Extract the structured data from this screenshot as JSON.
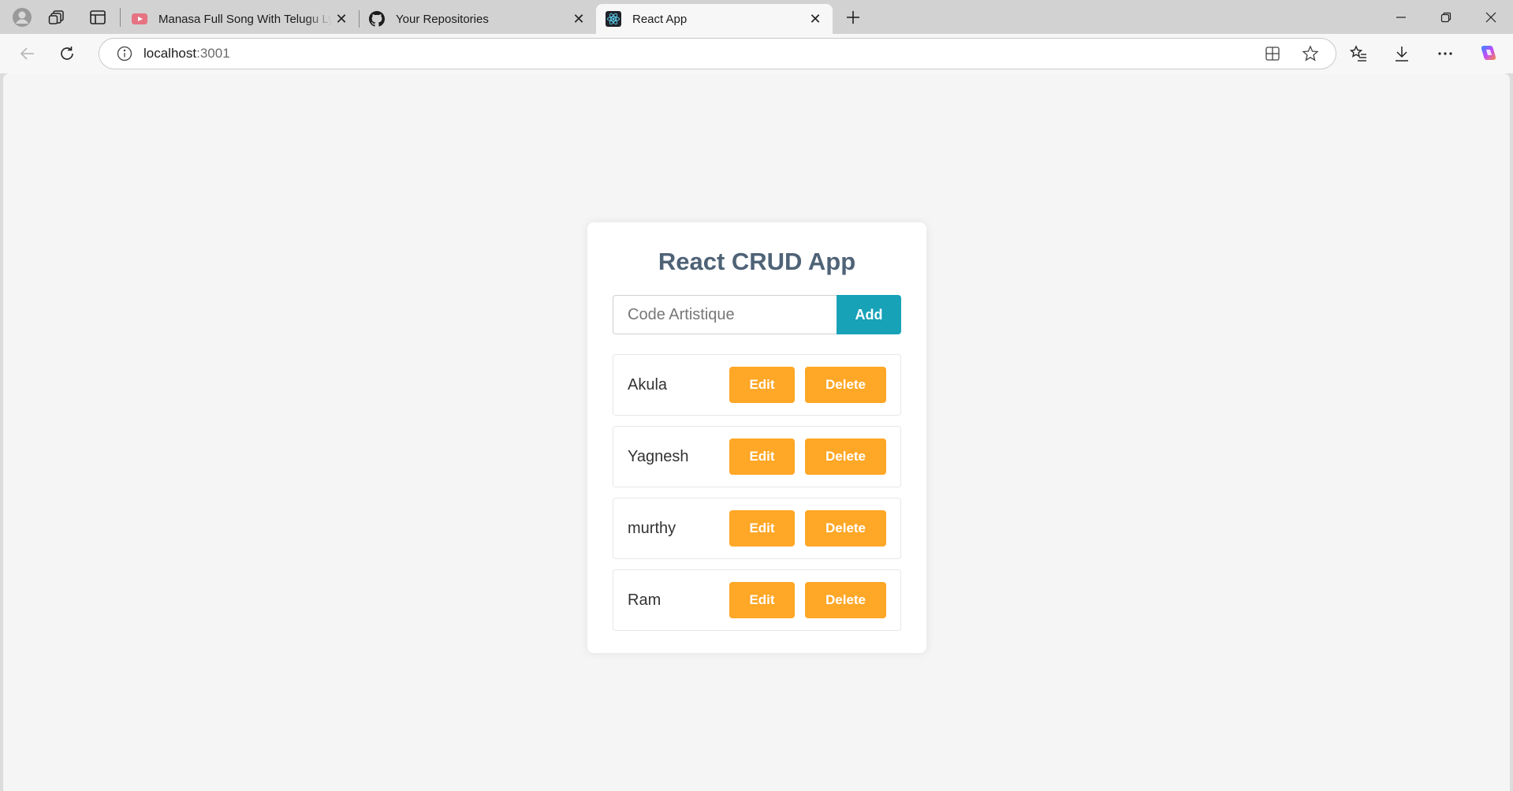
{
  "browser": {
    "tabs": [
      {
        "title": "Manasa Full Song With Telugu Lyrics",
        "favicon": "youtube-icon",
        "active": false
      },
      {
        "title": "Your Repositories",
        "favicon": "github-icon",
        "active": false
      },
      {
        "title": "React App",
        "favicon": "react-icon",
        "active": true
      }
    ],
    "address": {
      "host": "localhost",
      "port": ":3001"
    }
  },
  "app": {
    "title": "React CRUD App",
    "input": {
      "value": "",
      "placeholder": "Code Artistique"
    },
    "add_label": "Add",
    "items": [
      {
        "name": "Akula",
        "edit_label": "Edit",
        "delete_label": "Delete"
      },
      {
        "name": "Yagnesh",
        "edit_label": "Edit",
        "delete_label": "Delete"
      },
      {
        "name": "murthy",
        "edit_label": "Edit",
        "delete_label": "Delete"
      },
      {
        "name": "Ram",
        "edit_label": "Edit",
        "delete_label": "Delete"
      }
    ]
  },
  "colors": {
    "accent": "#17a2b8",
    "action": "#ffa726",
    "title": "#4f6377"
  }
}
